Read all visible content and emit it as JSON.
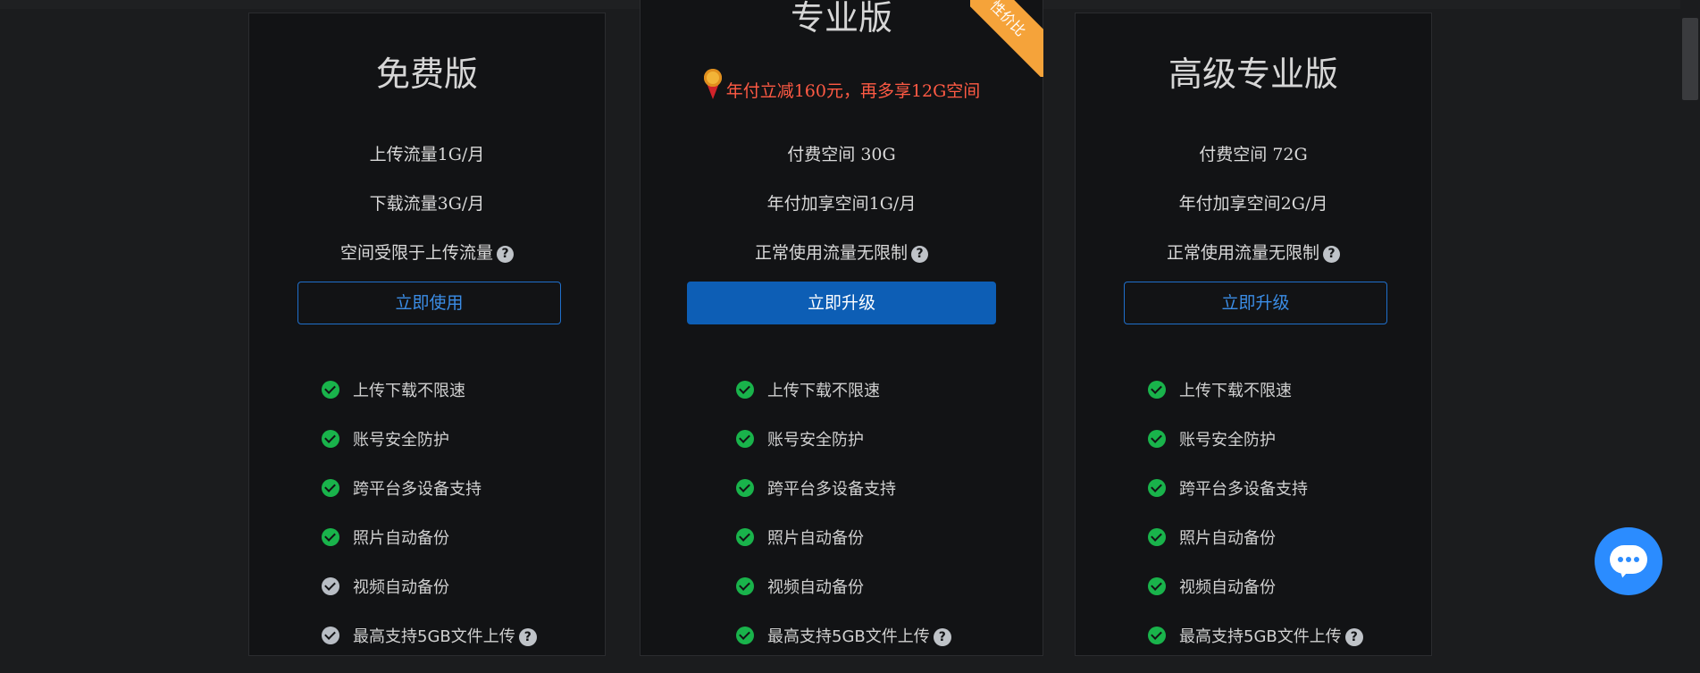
{
  "plans": [
    {
      "title": "免费版",
      "specs": [
        "上传流量1G/月",
        "下载流量3G/月",
        "空间受限于上传流量"
      ],
      "button_label": "立即使用",
      "features": [
        "上传下载不限速",
        "账号安全防护",
        "跨平台多设备支持",
        "照片自动备份",
        "视频自动备份",
        "最高支持5GB文件上传"
      ]
    },
    {
      "title": "专业版",
      "badge": "性价比",
      "promo": "年付立减160元，再多享12G空间",
      "specs": [
        "付费空间 30G",
        "年付加享空间1G/月",
        "正常使用流量无限制"
      ],
      "button_label": "立即升级",
      "features": [
        "上传下载不限速",
        "账号安全防护",
        "跨平台多设备支持",
        "照片自动备份",
        "视频自动备份",
        "最高支持5GB文件上传"
      ]
    },
    {
      "title": "高级专业版",
      "specs": [
        "付费空间 72G",
        "年付加享空间2G/月",
        "正常使用流量无限制"
      ],
      "button_label": "立即升级",
      "features": [
        "上传下载不限速",
        "账号安全防护",
        "跨平台多设备支持",
        "照片自动备份",
        "视频自动备份",
        "最高支持5GB文件上传"
      ]
    }
  ],
  "help_glyph": "?",
  "colors": {
    "background": "#1b1c1e",
    "card": "#121315",
    "primary_blue": "#0d5eb5",
    "outline_blue": "#3b8de6",
    "check_green": "#19b34b",
    "promo_red": "#ff5a44",
    "ribbon_orange": "#f5a33a",
    "chat_blue": "#2b8cff"
  },
  "icons": {
    "check": "check-circle-icon",
    "help": "question-circle-icon",
    "medal": "medal-icon",
    "chat": "chat-icon"
  }
}
